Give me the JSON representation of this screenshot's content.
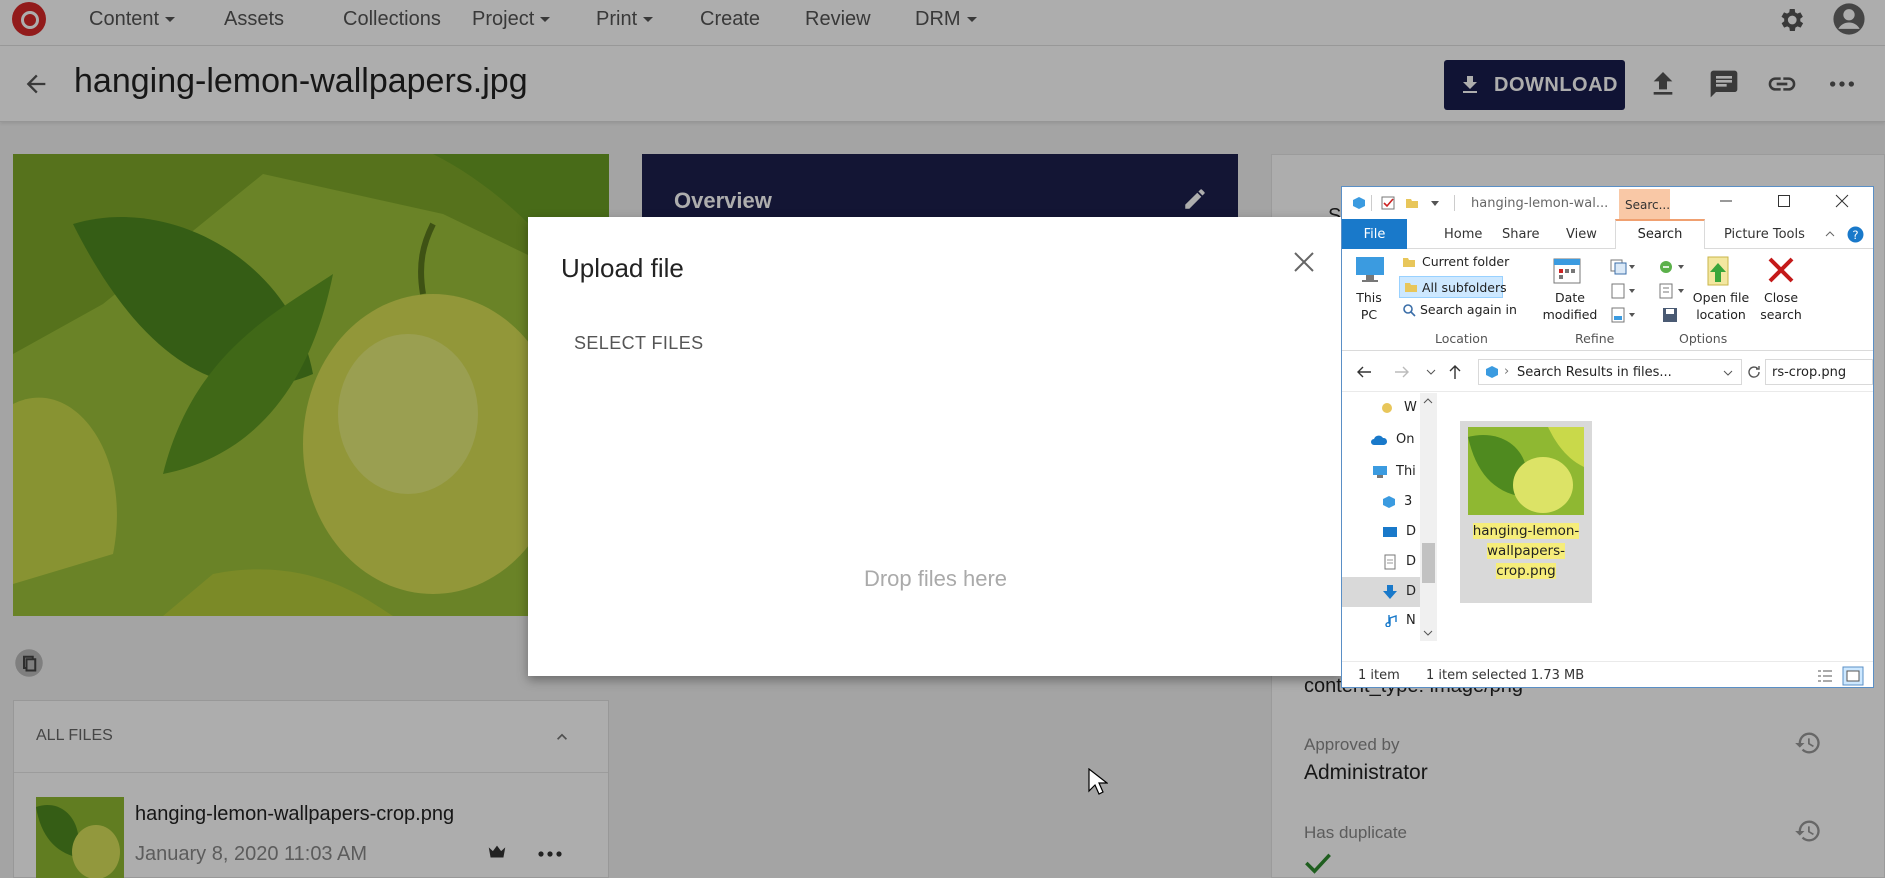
{
  "nav": {
    "items": [
      "Content",
      "Assets",
      "Collections",
      "Project",
      "Print",
      "Create",
      "Review",
      "DRM"
    ]
  },
  "header": {
    "title": "hanging-lemon-wallpapers.jpg",
    "download_label": "DOWNLOAD"
  },
  "overview": {
    "label": "Overview"
  },
  "files": {
    "section_label": "ALL FILES",
    "item_name": "hanging-lemon-wallpapers-crop.png",
    "item_date": "January 8, 2020 11:03 AM"
  },
  "metadata": {
    "partial_label": "SY",
    "content_type": "content_type: image/png",
    "approved_label": "Approved by",
    "approved_value": "Administrator",
    "duplicate_label": "Has duplicate"
  },
  "dialog": {
    "title": "Upload file",
    "select_files": "SELECT FILES",
    "drop_text": "Drop files here"
  },
  "explorer": {
    "title": "hanging-lemon-wal...",
    "context_tab": "Searc...",
    "tabs": {
      "file": "File",
      "home": "Home",
      "share": "Share",
      "view": "View",
      "search": "Search",
      "picture_tools": "Picture Tools"
    },
    "ribbon": {
      "this_pc": "This PC",
      "current_folder": "Current folder",
      "all_subfolders": "All subfolders",
      "search_again": "Search again in",
      "date_modified": "Date modified",
      "open_location": "Open file location",
      "close_search": "Close search",
      "group_location": "Location",
      "group_refine": "Refine",
      "group_options": "Options"
    },
    "address": "Search Results in files...",
    "search_value": "rs-crop.png",
    "nav_items": [
      "W",
      "On",
      "Thi",
      "3",
      "D",
      "D",
      "D",
      "N"
    ],
    "file_name": "hanging-lemon-wallpapers-crop.png",
    "file_name_lines": [
      "hanging-lemon-",
      "wallpapers-",
      "crop.png"
    ],
    "status_count": "1 item",
    "status_selected": "1 item selected  1.73 MB"
  },
  "colors": {
    "brand_red": "#d82828",
    "download_bg": "#181c4d",
    "overview_bg": "#1c1f4d",
    "explorer_file_tab": "#1979ca",
    "search_context": "#f9c8a6"
  }
}
